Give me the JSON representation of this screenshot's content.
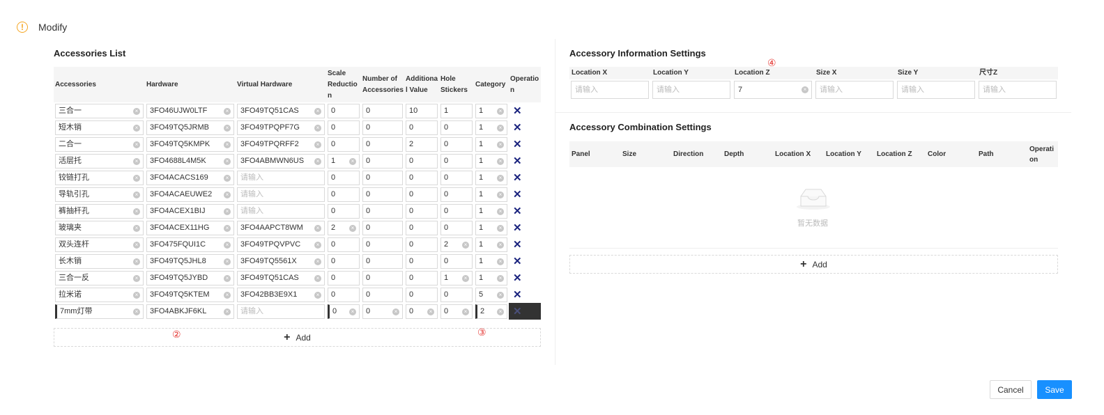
{
  "header": {
    "title": "Modify"
  },
  "accessories": {
    "title": "Accessories List",
    "columns": [
      "Accessories",
      "Hardware",
      "Virtual Hardware",
      "Scale Reductio n",
      "Number of Accessories",
      "Additiona l Value",
      "Hole Stickers",
      "Category",
      "Operatio n"
    ],
    "placeholder": "请输入",
    "rows": [
      [
        "三合一",
        "3FO46UJW0LTF",
        "3FO49TQ51CAS",
        "0",
        "0",
        "10",
        "1",
        "1"
      ],
      [
        "短木销",
        "3FO49TQ5JRMB",
        "3FO49TPQPF7G",
        "0",
        "0",
        "0",
        "0",
        "1"
      ],
      [
        "二合一",
        "3FO49TQ5KMPK",
        "3FO49TPQRFF2",
        "0",
        "0",
        "2",
        "0",
        "1"
      ],
      [
        "活层托",
        "3FO4688L4M5K",
        "3FO4ABMWN6US",
        "1",
        "0",
        "0",
        "0",
        "1"
      ],
      [
        "铰链打孔",
        "3FO4ACACS169",
        "",
        "0",
        "0",
        "0",
        "0",
        "1"
      ],
      [
        "导轨引孔",
        "3FO4ACAEUWE2",
        "",
        "0",
        "0",
        "0",
        "0",
        "1"
      ],
      [
        "裤抽杆孔",
        "3FO4ACEX1BIJ",
        "",
        "0",
        "0",
        "0",
        "0",
        "1"
      ],
      [
        "玻璃夹",
        "3FO4ACEX11HG",
        "3FO4AAPCT8WM",
        "2",
        "0",
        "0",
        "0",
        "1"
      ],
      [
        "双头连杆",
        "3FO475FQUI1C",
        "3FO49TPQVPVC",
        "0",
        "0",
        "0",
        "2",
        "1"
      ],
      [
        "长木销",
        "3FO49TQ5JHL8",
        "3FO49TQ5561X",
        "0",
        "0",
        "0",
        "0",
        "1"
      ],
      [
        "三合一反",
        "3FO49TQ5JYBD",
        "3FO49TQ51CAS",
        "0",
        "0",
        "0",
        "1",
        "1"
      ],
      [
        "拉米诺",
        "3FO49TQ5KTEM",
        "3FO42BB3E9X1",
        "0",
        "0",
        "0",
        "0",
        "5"
      ],
      [
        "7mm灯带",
        "3FO4ABKJF6KL",
        "",
        "0",
        "0",
        "0",
        "0",
        "2"
      ]
    ],
    "add_label": "Add",
    "markers": [
      "②",
      "③"
    ]
  },
  "info_settings": {
    "title": "Accessory Information Settings",
    "marker": "④",
    "columns": [
      "Location X",
      "Location Y",
      "Location Z",
      "Size X",
      "Size Y",
      "尺寸Z"
    ],
    "values": [
      "",
      "",
      "7",
      "",
      "",
      ""
    ],
    "placeholder": "请输入"
  },
  "combination_settings": {
    "title": "Accessory Combination Settings",
    "columns": [
      "Panel",
      "Size",
      "Direction",
      "Depth",
      "Location X",
      "Location Y",
      "Location Z",
      "Color",
      "Path",
      "Operati on"
    ],
    "empty_text": "暂无数据",
    "add_label": "Add"
  },
  "footer": {
    "cancel_label": "Cancel",
    "save_label": "Save"
  },
  "colors": {
    "primary": "#1890ff",
    "warning": "#f5a623",
    "marker": "#e53935",
    "delete": "#1a237e"
  }
}
